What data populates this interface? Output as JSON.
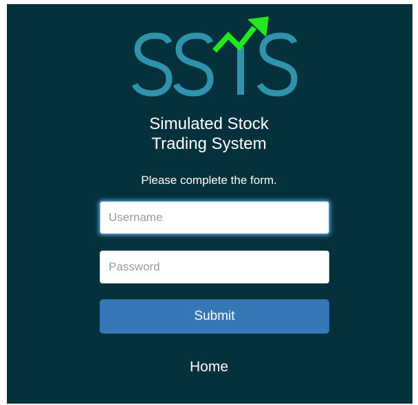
{
  "brand": {
    "logo_text": "SSTS",
    "logo_color": "#2f93ad",
    "arrow_color": "#24e81e"
  },
  "title": {
    "line1": "Simulated Stock",
    "line2": "Trading System"
  },
  "form": {
    "instruction": "Please complete the form.",
    "username_placeholder": "Username",
    "username_value": "",
    "password_placeholder": "Password",
    "password_value": "",
    "submit_label": "Submit"
  },
  "nav": {
    "home_label": "Home"
  },
  "colors": {
    "background": "#05313d",
    "button": "#3678b5",
    "focus": "#66afe9",
    "text": "#ffffff"
  }
}
